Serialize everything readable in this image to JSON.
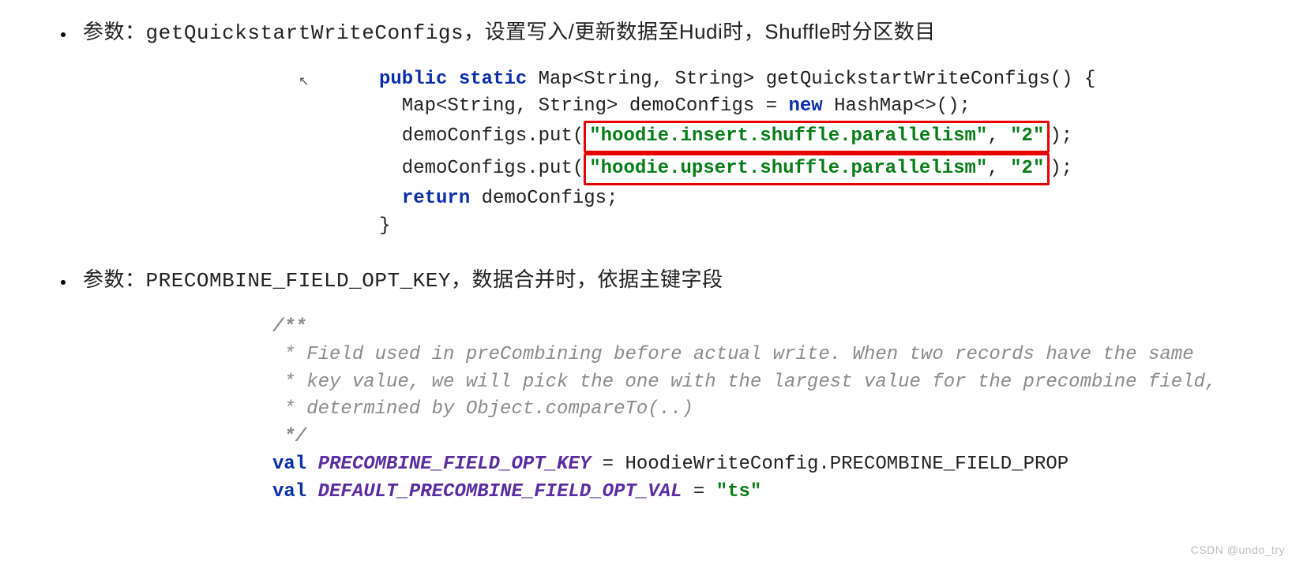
{
  "bullets": [
    {
      "prefix": "参数：",
      "code": "getQuickstartWriteConfigs",
      "suffix": "，设置写入/更新数据至Hudi时，Shuffle时分区数目"
    },
    {
      "prefix": "参数：",
      "code": "PRECOMBINE_FIELD_OPT_KEY",
      "suffix": "，数据合并时，依据主键字段"
    }
  ],
  "java": {
    "kw_public": "public",
    "kw_static": "static",
    "sig_after": " Map<String, String> getQuickstartWriteConfigs() {",
    "line2a": "  Map<String, String> demoConfigs = ",
    "kw_new": "new",
    "line2b": " HashMap<>();",
    "line3_pre": "  demoConfigs.put(",
    "line3_box_s1": "\"hoodie.insert.shuffle.parallelism\"",
    "line3_box_mid": ", ",
    "line3_box_s2": "\"2\"",
    "line3_post": ");",
    "line4_pre": "  demoConfigs.put(",
    "line4_box_s1": "\"hoodie.upsert.shuffle.parallelism\"",
    "line4_box_mid": ", ",
    "line4_box_s2": "\"2\"",
    "line4_post": ");",
    "kw_return": "return",
    "line5_after": " demoConfigs;",
    "line6": "}"
  },
  "scala": {
    "c1": "/**",
    "c2": " * Field used in preCombining before actual write. When two records have the same",
    "c3": " * key value, we will pick the one with the largest value for the precombine field,",
    "c4": " * determined by Object.compareTo(..)",
    "c5": " */",
    "kw_val": "val",
    "id1": "PRECOMBINE_FIELD_OPT_KEY",
    "eq": " = ",
    "rhs1": "HoodieWriteConfig.PRECOMBINE_FIELD_PROP",
    "id2": "DEFAULT_PRECOMBINE_FIELD_OPT_VAL",
    "rhs2_str": "\"ts\""
  },
  "watermark": "CSDN @undo_try"
}
